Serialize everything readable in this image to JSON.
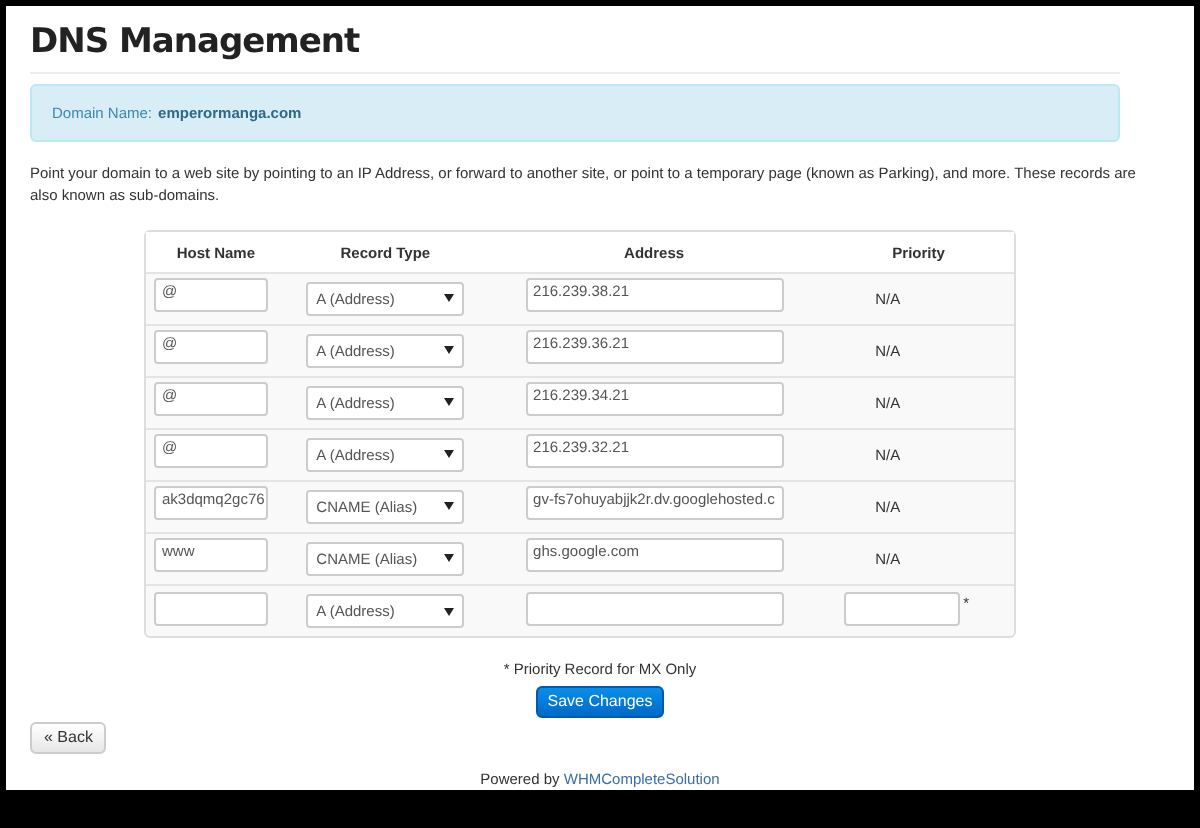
{
  "page": {
    "title": "DNS Management"
  },
  "domain": {
    "label": "Domain Name:",
    "value": "emperormanga.com"
  },
  "intro": "Point your domain to a web site by pointing to an IP Address, or forward to another site, or point to a temporary page (known as Parking), and more. These records are also known as sub-domains.",
  "table": {
    "columns": [
      "Host Name",
      "Record Type",
      "Address",
      "Priority"
    ],
    "rows": [
      {
        "host": "@",
        "type": "A (Address)",
        "address": "216.239.38.21",
        "priority": {
          "kind": "text",
          "value": "N/A"
        }
      },
      {
        "host": "@",
        "type": "A (Address)",
        "address": "216.239.36.21",
        "priority": {
          "kind": "text",
          "value": "N/A"
        }
      },
      {
        "host": "@",
        "type": "A (Address)",
        "address": "216.239.34.21",
        "priority": {
          "kind": "text",
          "value": "N/A"
        }
      },
      {
        "host": "@",
        "type": "A (Address)",
        "address": "216.239.32.21",
        "priority": {
          "kind": "text",
          "value": "N/A"
        }
      },
      {
        "host": "ak3dqmq2gc76",
        "type": "CNAME (Alias)",
        "address": "gv-fs7ohuyabjjk2r.dv.googlehosted.c",
        "priority": {
          "kind": "text",
          "value": "N/A"
        }
      },
      {
        "host": "www",
        "type": "CNAME (Alias)",
        "address": "ghs.google.com",
        "priority": {
          "kind": "text",
          "value": "N/A"
        }
      },
      {
        "type": "A (Address)",
        "priority": {
          "kind": "field",
          "note": "*"
        }
      }
    ]
  },
  "footnote": "* Priority Record for MX Only",
  "buttons": {
    "save": "Save Changes",
    "back": "« Back"
  },
  "footer": {
    "text": "Powered by",
    "link": "WHMCompleteSolution"
  }
}
